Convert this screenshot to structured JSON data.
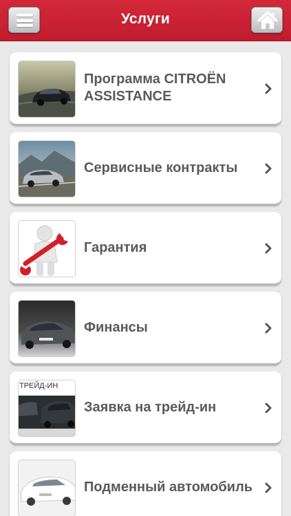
{
  "header": {
    "title": "Услуги",
    "menu_icon": "hamburger-menu-icon",
    "home_icon": "home-icon"
  },
  "colors": {
    "header": "#c7202f",
    "card_text": "#5a5a5a",
    "background": "#e9e9e9"
  },
  "services": [
    {
      "label": "Программа CITROËN ASSISTANCE",
      "thumb": "dark-car-road"
    },
    {
      "label": "Сервисные контракты",
      "thumb": "silver-car-mountains"
    },
    {
      "label": "Гарантия",
      "thumb": "figure-with-wrench"
    },
    {
      "label": "Финансы",
      "thumb": "dark-gray-car"
    },
    {
      "label": "Заявка на трейд-ин",
      "thumb": "trade-in-cars",
      "thumb_caption": "ТРЕЙД-ИН"
    },
    {
      "label": "Подменный автомобиль",
      "thumb": "white-car-studio"
    }
  ]
}
